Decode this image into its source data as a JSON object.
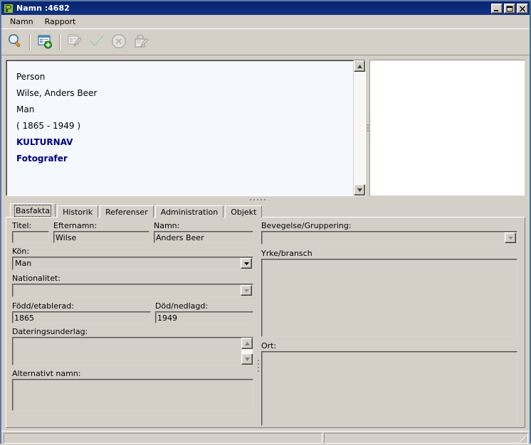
{
  "window": {
    "title": "Namn :4682",
    "app_icon": "primus-p-icon",
    "controls": {
      "minimize": "minimize-icon",
      "maximize": "maximize-icon",
      "close": "close-icon"
    }
  },
  "menubar": {
    "items": [
      {
        "label": "Namn"
      },
      {
        "label": "Rapport"
      }
    ]
  },
  "toolbar": {
    "buttons": [
      {
        "name": "search-button",
        "icon": "magnifier-icon",
        "enabled": true
      },
      {
        "name": "new-record-button",
        "icon": "new-record-plus-icon",
        "enabled": true
      },
      {
        "name": "edit-record-button",
        "icon": "edit-record-pencil-icon",
        "enabled": false
      },
      {
        "name": "confirm-button",
        "icon": "checkmark-icon",
        "enabled": false
      },
      {
        "name": "cancel-button",
        "icon": "cancel-octagon-x-icon",
        "enabled": false
      },
      {
        "name": "lock-edit-button",
        "icon": "lock-pencil-icon",
        "enabled": false
      }
    ]
  },
  "info_panel": {
    "lines": [
      {
        "text": "Person",
        "link": false
      },
      {
        "text": "Wilse, Anders Beer",
        "link": false
      },
      {
        "text": "Man",
        "link": false
      },
      {
        "text": "( 1865 - 1949 )",
        "link": false
      },
      {
        "text": "KULTURNAV",
        "link": true
      },
      {
        "text": "Fotografer",
        "link": true
      }
    ],
    "link_color": "#000080",
    "background": "#f5f8ff"
  },
  "preview_panel": {
    "background": "#ffffff",
    "content": ""
  },
  "tabs": [
    {
      "label": "Basfakta",
      "active": true
    },
    {
      "label": "Historik",
      "active": false
    },
    {
      "label": "Referenser",
      "active": false
    },
    {
      "label": "Administration",
      "active": false
    },
    {
      "label": "Objekt",
      "active": false
    }
  ],
  "form": {
    "left": {
      "titel": {
        "label": "Titel:",
        "value": ""
      },
      "efternamn": {
        "label": "Efternamn:",
        "value": "Wilse"
      },
      "namn": {
        "label": "Namn:",
        "value": "Anders Beer"
      },
      "kon": {
        "label": "Kön:",
        "value": "Man",
        "enabled": true
      },
      "nationalitet": {
        "label": "Nationalitet:",
        "value": "",
        "enabled": false
      },
      "fodd": {
        "label": "Född/etablerad:",
        "value": "1865"
      },
      "dod": {
        "label": "Död/nedlagd:",
        "value": "1949"
      },
      "dateringsunderlag": {
        "label": "Dateringsunderlag:",
        "value": ""
      },
      "alternativt_namn": {
        "label": "Alternativt namn:",
        "value": ""
      }
    },
    "right": {
      "bevegelse": {
        "label": "Bevegelse/Gruppering:",
        "value": "",
        "enabled": false
      },
      "yrke": {
        "label": "Yrke/bransch",
        "value": ""
      },
      "ort": {
        "label": "Ort:",
        "value": ""
      }
    }
  },
  "statusbar": {
    "pane1": "",
    "pane2": "",
    "grip": "resize-grip-icon"
  }
}
